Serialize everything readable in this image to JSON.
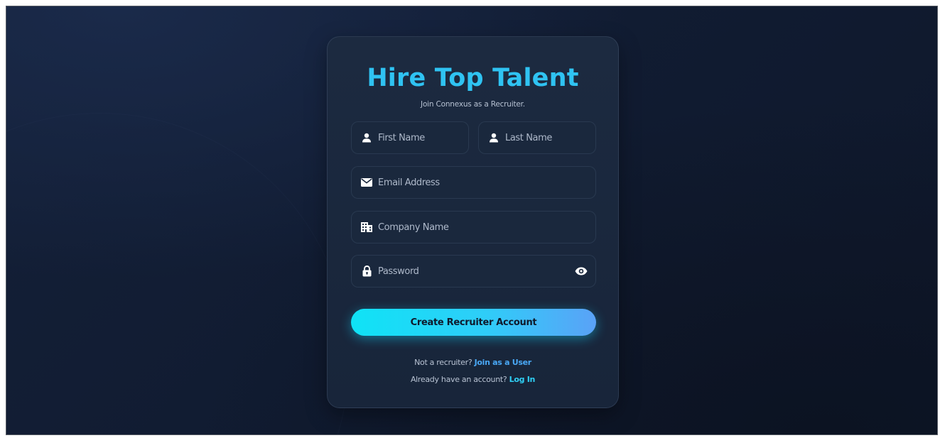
{
  "signup_card": {
    "title": "Hire Top Talent",
    "subtitle": "Join Connexus as a Recruiter.",
    "fields": {
      "first_name": {
        "placeholder": "First Name",
        "value": "",
        "icon": "user-icon"
      },
      "last_name": {
        "placeholder": "Last Name",
        "value": "",
        "icon": "user-icon"
      },
      "email": {
        "placeholder": "Email Address",
        "value": "",
        "icon": "envelope-icon"
      },
      "company": {
        "placeholder": "Company Name",
        "value": "",
        "icon": "building-icon"
      },
      "password": {
        "placeholder": "Password",
        "value": "",
        "icon": "lock-icon",
        "toggle_icon": "eye-icon"
      }
    },
    "submit_label": "Create Recruiter Account",
    "user_prompt": "Not a recruiter?",
    "user_link": "Join as a User",
    "login_prompt": "Already have an account?",
    "login_link": "Log In"
  },
  "colors": {
    "title": "#2fc3f2",
    "button_gradient_start": "#0fe3f6",
    "button_gradient_end": "#5aa2f7",
    "link_user": "#49a8f5",
    "link_login": "#2fd0f5",
    "card_bg": "#1b283e",
    "page_bg": "#121d33"
  }
}
